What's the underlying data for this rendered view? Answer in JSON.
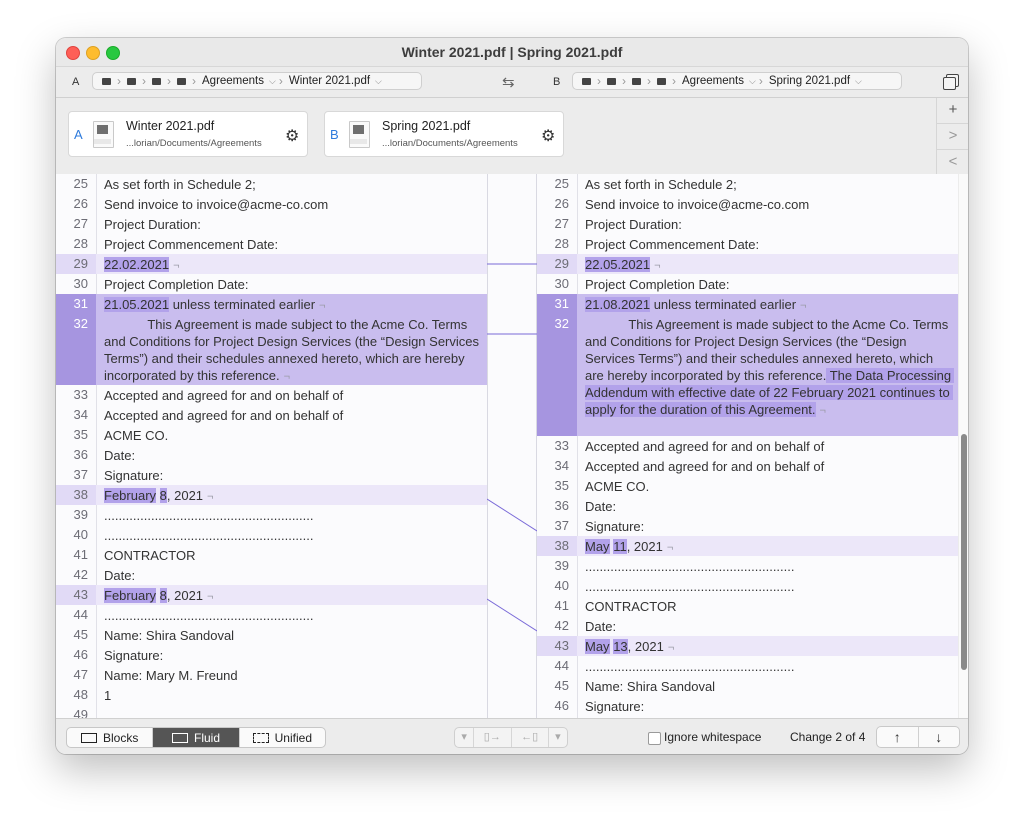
{
  "window": {
    "title": "Winter 2021.pdf | Spring 2021.pdf"
  },
  "pathbar": {
    "a_label": "A",
    "b_label": "B",
    "a_folder": "Agreements",
    "a_file": "Winter 2021.pdf",
    "b_folder": "Agreements",
    "b_file": "Spring 2021.pdf",
    "swap_icon": "⇆"
  },
  "files": {
    "a": {
      "letter": "A",
      "name": "Winter 2021.pdf",
      "path": "...lorian/Documents/Agreements"
    },
    "b": {
      "letter": "B",
      "name": "Spring 2021.pdf",
      "path": "...lorian/Documents/Agreements"
    }
  },
  "side_buttons": {
    "add": "+",
    "next": ">",
    "prev": "<"
  },
  "left_pane": {
    "lines": [
      {
        "n": "25",
        "t": "As set forth in Schedule 2;"
      },
      {
        "n": "26",
        "t": "Send invoice to invoice@acme-co.com"
      },
      {
        "n": "27",
        "t": " Project Duration:"
      },
      {
        "n": "28",
        "t": " Project Commencement Date:"
      },
      {
        "n": "29",
        "t": "22.02.2021"
      },
      {
        "n": "30",
        "t": "Project Completion Date:"
      },
      {
        "n": "31",
        "t": "21.05.2021",
        "t2": " unless terminated earlier"
      },
      {
        "n": "32",
        "t": "            This Agreement is made subject to the Acme Co. Terms and Conditions for Project Design Services (the “Design Services Terms”) and their schedules annexed hereto, which are hereby incorporated by this reference."
      },
      {
        "n": "33",
        "t": "Accepted and agreed for and on behalf of"
      },
      {
        "n": "34",
        "t": "Accepted and agreed for and on behalf of"
      },
      {
        "n": "35",
        "t": "ACME CO."
      },
      {
        "n": "36",
        "t": "Date:"
      },
      {
        "n": "37",
        "t": "Signature:"
      },
      {
        "n": "38",
        "t": "February",
        "t2": " ",
        "t3": "8",
        "t4": ", 2021"
      },
      {
        "n": "39",
        "t": "......................................................................."
      },
      {
        "n": "40",
        "t": "......................................................................."
      },
      {
        "n": "41",
        "t": "CONTRACTOR"
      },
      {
        "n": "42",
        "t": "Date:"
      },
      {
        "n": "43",
        "t": "February",
        "t2": " ",
        "t3": "8",
        "t4": ", 2021"
      },
      {
        "n": "44",
        "t": "......................................................................."
      },
      {
        "n": "45",
        "t": "Name: Shira Sandoval"
      },
      {
        "n": "46",
        "t": "Signature:"
      },
      {
        "n": "47",
        "t": "Name: Mary M. Freund"
      },
      {
        "n": "48",
        "t": "1"
      },
      {
        "n": "49",
        "t": "......................................................................."
      }
    ]
  },
  "right_pane": {
    "lines": [
      {
        "n": "25",
        "t": "As set forth in Schedule 2;"
      },
      {
        "n": "26",
        "t": "Send invoice to invoice@acme-co.com"
      },
      {
        "n": "27",
        "t": " Project Duration:"
      },
      {
        "n": "28",
        "t": " Project Commencement Date:"
      },
      {
        "n": "29",
        "t": "22.05.2021"
      },
      {
        "n": "30",
        "t": "Project Completion Date:"
      },
      {
        "n": "31",
        "t": "21.08.2021",
        "t2": " unless terminated earlier"
      },
      {
        "n": "32",
        "t": "            This Agreement is made subject to the Acme Co. Terms and Conditions for Project Design Services (the “Design Services Terms”) and their schedules annexed hereto, which are hereby incorporated by this reference.",
        "t2": " The Data Processing Addendum with effective date of 22 February 2021 continues to apply for the duration of this Agreement."
      },
      {
        "n": "33",
        "t": "Accepted and agreed for and on behalf of"
      },
      {
        "n": "34",
        "t": "Accepted and agreed for and on behalf of"
      },
      {
        "n": "35",
        "t": "ACME CO."
      },
      {
        "n": "36",
        "t": "Date:"
      },
      {
        "n": "37",
        "t": "Signature:"
      },
      {
        "n": "38",
        "t": "May",
        "t2": " ",
        "t3": "11",
        "t4": ", 2021"
      },
      {
        "n": "39",
        "t": "......................................................................."
      },
      {
        "n": "40",
        "t": "......................................................................."
      },
      {
        "n": "41",
        "t": "CONTRACTOR"
      },
      {
        "n": "42",
        "t": "Date:"
      },
      {
        "n": "43",
        "t": "May",
        "t2": " ",
        "t3": "13",
        "t4": ", 2021"
      },
      {
        "n": "44",
        "t": "......................................................................."
      },
      {
        "n": "45",
        "t": "Name: Shira Sandoval"
      },
      {
        "n": "46",
        "t": "Signature:"
      }
    ]
  },
  "bottom": {
    "modes": [
      "Blocks",
      "Fluid",
      "Unified"
    ],
    "active_mode": "Fluid",
    "ignore_whitespace": "Ignore whitespace",
    "change_status": "Change 2 of 4",
    "up_arrow": "↑",
    "down_arrow": "↓"
  },
  "colors": {
    "accent": "#2f7bdc",
    "diff_light": "#ece7f9",
    "diff_dark": "#c9bdee",
    "diff_mark": "#b2a2ea"
  }
}
